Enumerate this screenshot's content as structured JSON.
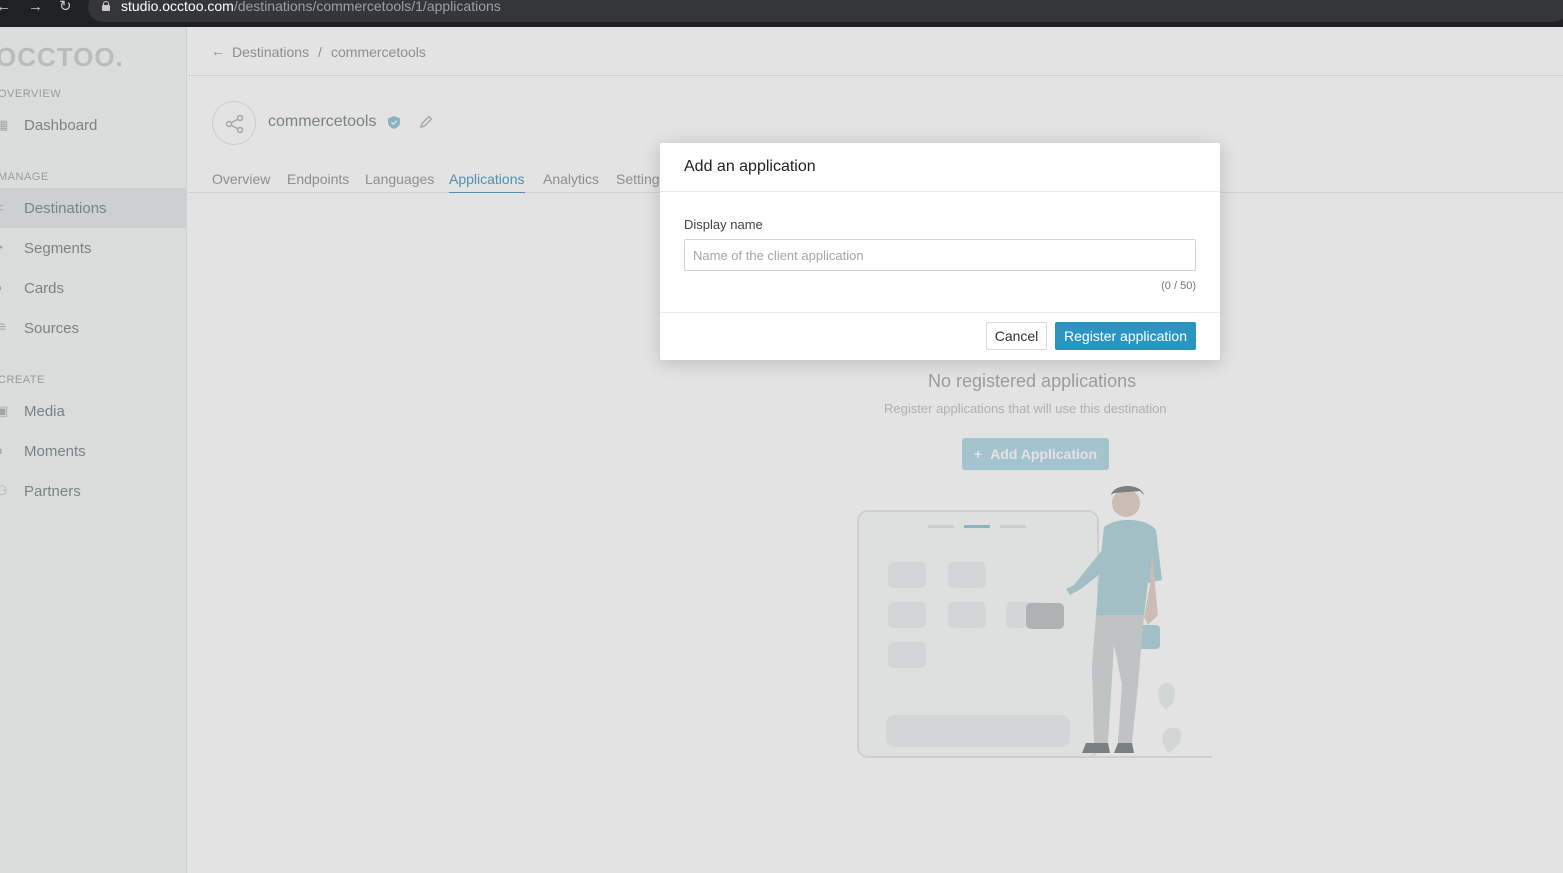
{
  "browser": {
    "back_icon": "back-arrow-icon",
    "forward_icon": "forward-arrow-icon",
    "reload_icon": "reload-icon",
    "url_host": "studio.occtoo.com",
    "url_path": "/destinations/commercetools/1/applications"
  },
  "sidebar": {
    "logo": "OCCTOO.",
    "sections": {
      "overview": "OVERVIEW",
      "manage": "MANAGE",
      "create": "CREATE"
    },
    "items": [
      {
        "label": "Dashboard",
        "icon": "dashboard-icon"
      },
      {
        "label": "Destinations",
        "icon": "share-icon"
      },
      {
        "label": "Segments",
        "icon": "pie-icon"
      },
      {
        "label": "Cards",
        "icon": "cards-icon"
      },
      {
        "label": "Sources",
        "icon": "database-icon"
      },
      {
        "label": "Media",
        "icon": "image-icon"
      },
      {
        "label": "Moments",
        "icon": "moments-icon"
      },
      {
        "label": "Partners",
        "icon": "partners-icon"
      }
    ]
  },
  "breadcrumb": {
    "parent": "Destinations",
    "separator": "/",
    "current": "commercetools"
  },
  "destination": {
    "name": "commercetools"
  },
  "tabs": [
    "Overview",
    "Endpoints",
    "Languages",
    "Applications",
    "Analytics",
    "Settings"
  ],
  "empty_state": {
    "title": "No registered applications",
    "subtitle": "Register applications that will use this destination",
    "button": "Add Application",
    "button_icon": "plus-icon"
  },
  "modal": {
    "title": "Add an application",
    "field_label": "Display name",
    "field_value": "",
    "field_placeholder": "Name of the client application",
    "counter": "(0 / 50)",
    "cancel": "Cancel",
    "submit": "Register application"
  },
  "colors": {
    "accent": "#2b95c1",
    "browser_bar": "#202124"
  }
}
